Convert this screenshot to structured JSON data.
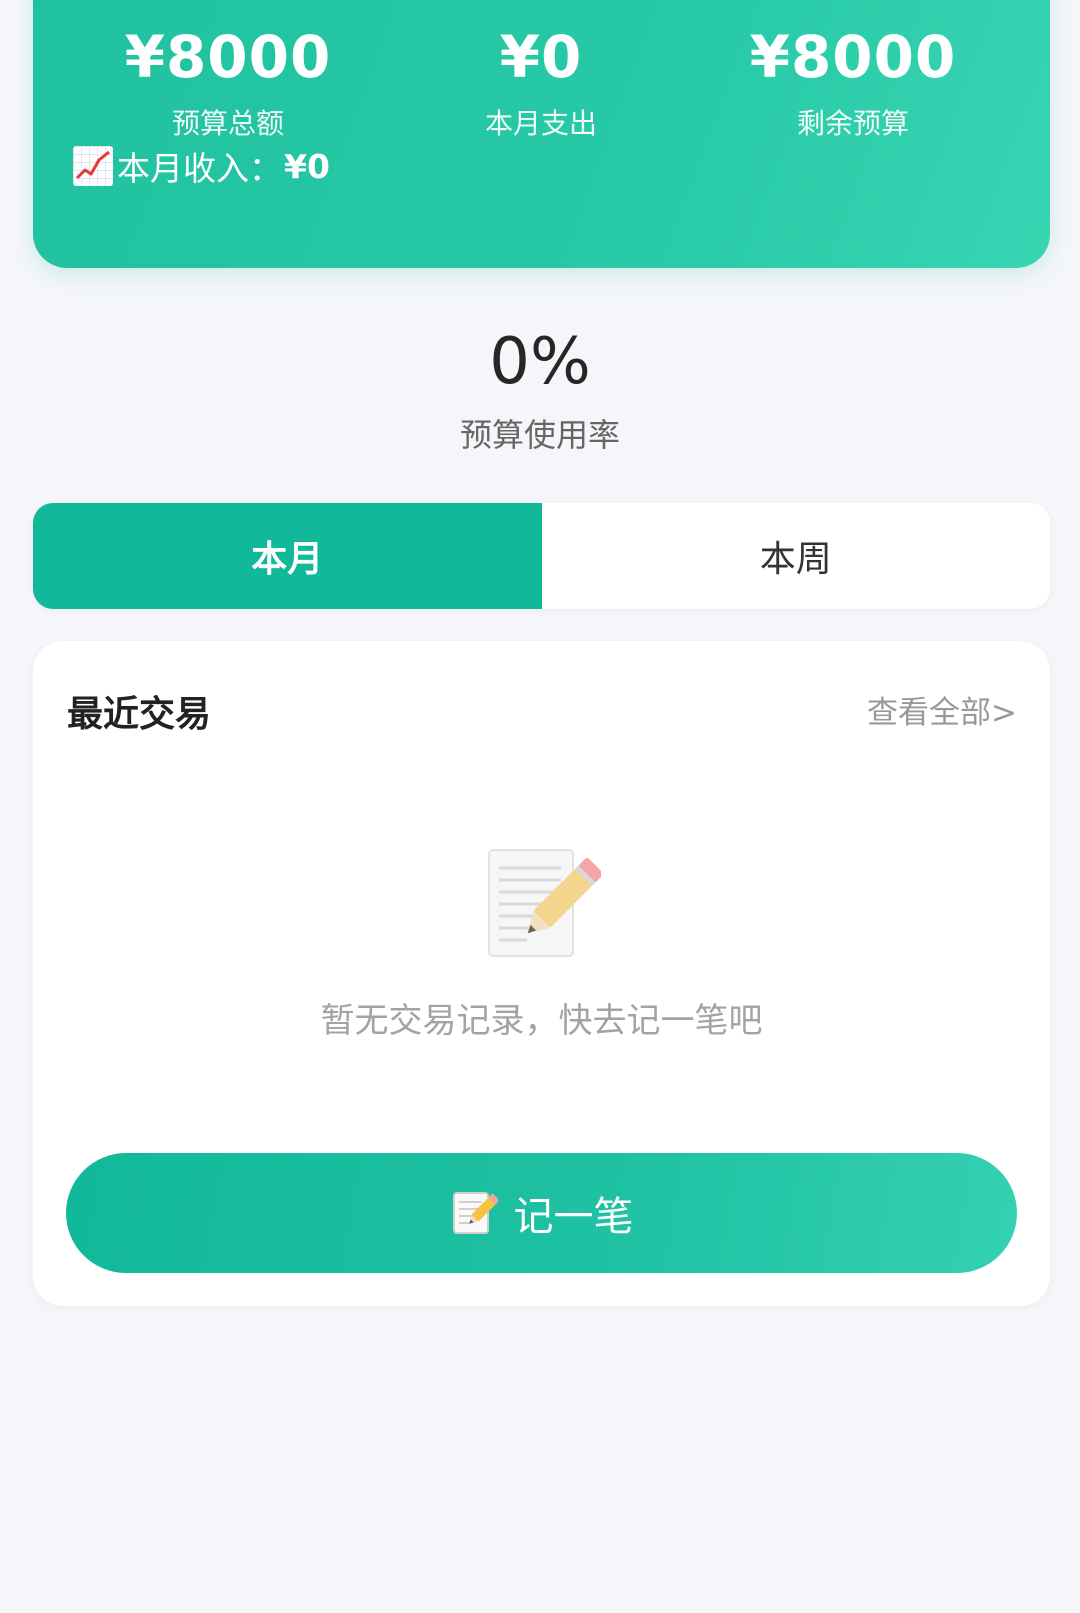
{
  "summary": {
    "budget_total": {
      "amount": "¥8000",
      "label": "预算总额"
    },
    "month_expense": {
      "amount": "¥0",
      "label": "本月支出"
    },
    "remaining": {
      "amount": "¥8000",
      "label": "剩余预算"
    },
    "income": {
      "label": "本月收入：",
      "value": "¥0",
      "icon": "chart-up-icon"
    }
  },
  "usage": {
    "percent": "0%",
    "label": "预算使用率"
  },
  "tabs": [
    {
      "label": "本月",
      "active": true
    },
    {
      "label": "本周",
      "active": false
    }
  ],
  "recent": {
    "title": "最近交易",
    "view_all": "查看全部>",
    "empty_text": "暂无交易记录，快去记一笔吧",
    "empty_icon": "memo-icon"
  },
  "add_button": {
    "label": "记一笔",
    "icon": "memo-icon"
  },
  "colors": {
    "accent": "#12b89a",
    "summary_bg": "#27c9a6",
    "page_bg": "#f4f6f9",
    "muted_text": "#a3a3a3"
  }
}
